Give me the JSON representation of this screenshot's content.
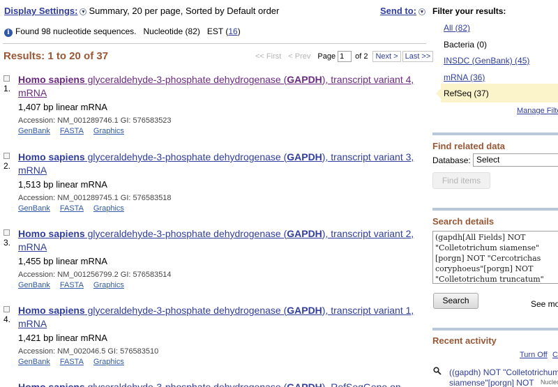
{
  "header": {
    "display_settings_label": "Display Settings:",
    "display_settings_value": "Summary, 20 per page, Sorted by Default order",
    "send_to_label": "Send to:"
  },
  "found": {
    "text": "Found 98 nucleotide sequences.",
    "nucleotide": "Nucleotide (82)",
    "est_label": "EST (",
    "est_count": "16",
    "est_close": ")"
  },
  "results_title": "Results: 1 to 20 of 37",
  "pager": {
    "first": "<< First",
    "prev": "< Prev",
    "page_label": "Page",
    "page_value": "1",
    "of": "of 2",
    "next": "Next >",
    "last": "Last >>"
  },
  "results": [
    {
      "num": "1.",
      "org": "Homo sapiens",
      "pre": " glyceraldehyde-3-phosphate dehydrogenase (",
      "gene": "GAPDH",
      "post": "), transcript variant 4, mRNA",
      "desc": "1,407 bp linear mRNA",
      "accession": "Accession: NM_001289746.1   GI: 576583523",
      "links": [
        "GenBank",
        "FASTA",
        "Graphics"
      ]
    },
    {
      "num": "2.",
      "org": "Homo sapiens",
      "pre": " glyceraldehyde-3-phosphate dehydrogenase (",
      "gene": "GAPDH",
      "post": "), transcript variant 3, mRNA",
      "desc": "1,513 bp linear mRNA",
      "accession": "Accession: NM_001289745.1   GI: 576583518",
      "links": [
        "GenBank",
        "FASTA",
        "Graphics"
      ]
    },
    {
      "num": "3.",
      "org": "Homo sapiens",
      "pre": " glyceraldehyde-3-phosphate dehydrogenase (",
      "gene": "GAPDH",
      "post": "), transcript variant 2, mRNA",
      "desc": "1,455 bp linear mRNA",
      "accession": "Accession: NM_001256799.2   GI: 576583514",
      "links": [
        "GenBank",
        "FASTA",
        "Graphics"
      ]
    },
    {
      "num": "4.",
      "org": "Homo sapiens",
      "pre": " glyceraldehyde-3-phosphate dehydrogenase (",
      "gene": "GAPDH",
      "post": "), transcript variant 1, mRNA",
      "desc": "1,421 bp linear mRNA",
      "accession": "Accession: NM_002046.5   GI: 576583510",
      "links": [
        "GenBank",
        "FASTA",
        "Graphics"
      ]
    },
    {
      "num": "",
      "org": "Homo sapiens",
      "pre": " glyceraldehyde-3-phosphate dehydrogenase (",
      "gene": "GAPDH",
      "post": "), RefSeqGene on",
      "desc": "",
      "accession": "",
      "links": []
    }
  ],
  "filters": {
    "title": "Filter your results:",
    "items": [
      "All (82)",
      "Bacteria (0)",
      "INSDC (GenBank) (45)",
      "mRNA (36)",
      "RefSeq (37)"
    ],
    "manage": "Manage Filters"
  },
  "find_related": {
    "title": "Find related data",
    "db_label": "Database:",
    "db_value": "Select",
    "button": "Find items"
  },
  "search_details": {
    "title": "Search details",
    "query": "(gapdh[All Fields] NOT\n\"Colletotrichum siamense\"\n[porgn] NOT \"Cercotrichas\ncoryphoeus\"[porgn] NOT\n\"Colletotrichum truncatum\"",
    "button": "Search",
    "see_more": "See more..."
  },
  "recent_activity": {
    "title": "Recent activity",
    "turn_off": "Turn Off",
    "clear": "Clear",
    "line1": "((gapdh) NOT \"Colletotrichum",
    "line2": "siamense\"[porgn] NOT",
    "db": "Nucleotide"
  },
  "colors": {
    "link": "#2f3d9e",
    "visited": "#6b2a80",
    "heading": "#985735",
    "highlight": "#fbf3c9"
  }
}
